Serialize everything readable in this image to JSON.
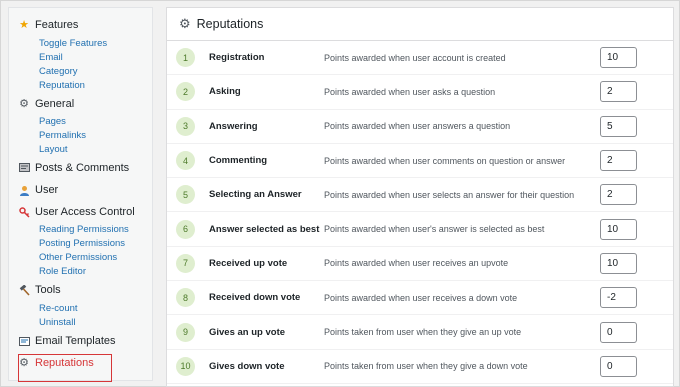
{
  "sidebar": {
    "features": {
      "label": "Features",
      "icon": "star-icon",
      "items": [
        "Toggle Features",
        "Email",
        "Category",
        "Reputation"
      ]
    },
    "general": {
      "label": "General",
      "icon": "gear-icon",
      "items": [
        "Pages",
        "Permalinks",
        "Layout"
      ]
    },
    "posts_comments": {
      "label": "Posts & Comments",
      "icon": "posts-icon"
    },
    "user": {
      "label": "User",
      "icon": "user-icon"
    },
    "uac": {
      "label": "User Access Control",
      "icon": "key-icon",
      "items": [
        "Reading Permissions",
        "Posting Permissions",
        "Other Permissions",
        "Role Editor"
      ]
    },
    "tools": {
      "label": "Tools",
      "icon": "hammer-icon",
      "items": [
        "Re-count",
        "Uninstall"
      ]
    },
    "email_templates": {
      "label": "Email Templates",
      "icon": "email-template-icon"
    },
    "reputations": {
      "label": "Reputations",
      "icon": "gear-icon"
    }
  },
  "panel": {
    "title": "Reputations",
    "rows": [
      {
        "num": "1",
        "label": "Registration",
        "desc": "Points awarded when user account is created",
        "value": "10"
      },
      {
        "num": "2",
        "label": "Asking",
        "desc": "Points awarded when user asks a question",
        "value": "2"
      },
      {
        "num": "3",
        "label": "Answering",
        "desc": "Points awarded when user answers a question",
        "value": "5"
      },
      {
        "num": "4",
        "label": "Commenting",
        "desc": "Points awarded when user comments on question or answer",
        "value": "2"
      },
      {
        "num": "5",
        "label": "Selecting an Answer",
        "desc": "Points awarded when user selects an answer for their question",
        "value": "2"
      },
      {
        "num": "6",
        "label": "Answer selected as best",
        "desc": "Points awarded when user's answer is selected as best",
        "value": "10"
      },
      {
        "num": "7",
        "label": "Received up vote",
        "desc": "Points awarded when user receives an upvote",
        "value": "10"
      },
      {
        "num": "8",
        "label": "Received down vote",
        "desc": "Points awarded when user receives a down vote",
        "value": "-2"
      },
      {
        "num": "9",
        "label": "Gives an up vote",
        "desc": "Points taken from user when they give an up vote",
        "value": "0"
      },
      {
        "num": "10",
        "label": "Gives down vote",
        "desc": "Points taken from user when they give a down vote",
        "value": "0"
      }
    ]
  },
  "colors": {
    "link": "#2271b1",
    "active": "#d63638",
    "badge_bg": "#dfeecf",
    "badge_text": "#4d7a2a"
  }
}
